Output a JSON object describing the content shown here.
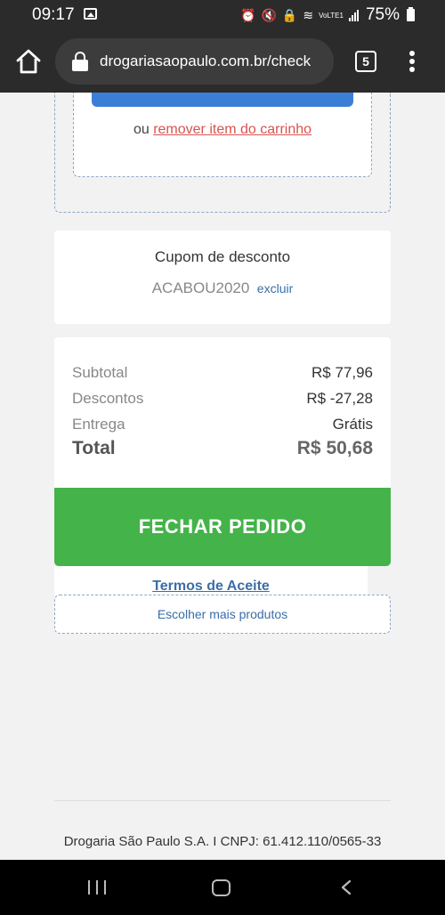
{
  "status_bar": {
    "time": "09:17",
    "battery": "75%",
    "volte_label": "VoLTE1"
  },
  "browser": {
    "url": "drogariasaopaulo.com.br/check",
    "tab_count": "5"
  },
  "cart": {
    "remove_prefix": "ou",
    "remove_link": "remover item do carrinho"
  },
  "coupon": {
    "title": "Cupom de desconto",
    "code": "ACABOU2020",
    "remove_label": "excluir"
  },
  "summary": {
    "subtotal_label": "Subtotal",
    "subtotal_value": "R$ 77,96",
    "discount_label": "Descontos",
    "discount_value": "R$ -27,28",
    "delivery_label": "Entrega",
    "delivery_value": "Grátis",
    "total_label": "Total",
    "total_value": "R$ 50,68"
  },
  "actions": {
    "checkout_label": "FECHAR PEDIDO",
    "terms_label": "Termos de Aceite",
    "more_products_label": "Escolher mais produtos"
  },
  "footer": {
    "text": "Drogaria São Paulo S.A. I CNPJ: 61.412.110/0565-33"
  },
  "colors": {
    "checkout_green": "#44b349",
    "link_blue": "#3a6ea8",
    "remove_red": "#d9534f",
    "primary_blue": "#3a7fd5"
  }
}
